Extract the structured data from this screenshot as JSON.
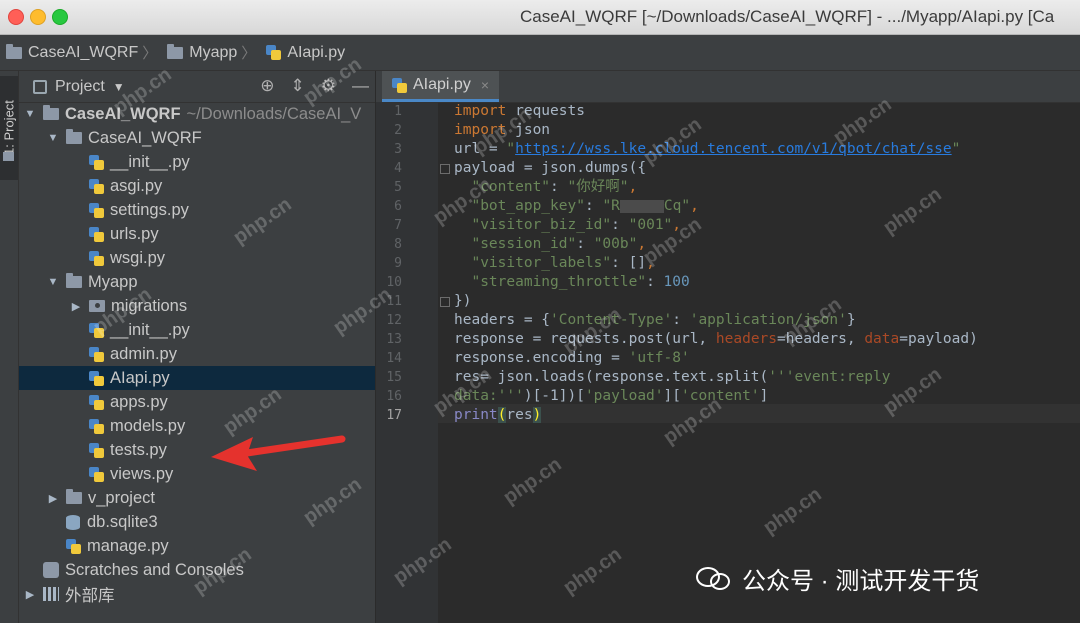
{
  "window": {
    "title": "CaseAI_WQRF [~/Downloads/CaseAI_WQRF] - .../Myapp/AIapi.py [Ca"
  },
  "breadcrumb": [
    "CaseAI_WQRF",
    "Myapp",
    "AIapi.py"
  ],
  "side_strip": {
    "tab_label": "1: Project"
  },
  "project_panel": {
    "title": "Project",
    "tools": [
      "⊕",
      "⇕",
      "⚙",
      "—"
    ],
    "tree": [
      {
        "label": "CaseAI_WQRF",
        "extra": "~/Downloads/CaseAI_V",
        "kind": "root",
        "arrow": "▼"
      },
      {
        "label": "CaseAI_WQRF",
        "kind": "folder",
        "arrow": "▼"
      },
      {
        "label": "__init__.py",
        "kind": "py"
      },
      {
        "label": "asgi.py",
        "kind": "py"
      },
      {
        "label": "settings.py",
        "kind": "py"
      },
      {
        "label": "urls.py",
        "kind": "py"
      },
      {
        "label": "wsgi.py",
        "kind": "py"
      },
      {
        "label": "Myapp",
        "kind": "folder",
        "arrow": "▼"
      },
      {
        "label": "migrations",
        "kind": "pkg",
        "arrow": "▶"
      },
      {
        "label": "__init__.py",
        "kind": "py"
      },
      {
        "label": "admin.py",
        "kind": "py"
      },
      {
        "label": "AIapi.py",
        "kind": "py",
        "selected": true
      },
      {
        "label": "apps.py",
        "kind": "py"
      },
      {
        "label": "models.py",
        "kind": "py"
      },
      {
        "label": "tests.py",
        "kind": "py"
      },
      {
        "label": "views.py",
        "kind": "py"
      },
      {
        "label": "v_project",
        "kind": "folder",
        "arrow": "▶"
      },
      {
        "label": "db.sqlite3",
        "kind": "db"
      },
      {
        "label": "manage.py",
        "kind": "py"
      },
      {
        "label": "Scratches and Consoles",
        "kind": "scratch"
      },
      {
        "label": "外部库",
        "kind": "lib",
        "arrow": "▶"
      }
    ]
  },
  "editor": {
    "tab_label": "AIapi.py",
    "tab_close": "×",
    "current_line": "17",
    "line_numbers": [
      "1",
      "2",
      "3",
      "4",
      "5",
      "6",
      "7",
      "8",
      "9",
      "10",
      "11",
      "12",
      "13",
      "14",
      "15",
      "16",
      "17"
    ]
  },
  "code": {
    "l1": {
      "kw": "import",
      "rest": " requests"
    },
    "l2": {
      "kw": "import",
      "rest": " json"
    },
    "l3": {
      "pre": "url = ",
      "q1": "\"",
      "url": "https://wss.lke.cloud.tencent.com/v1/qbot/chat/sse",
      "q2": "\""
    },
    "l4": "payload = json.dumps({",
    "l5": {
      "key": "\"content\"",
      "sep": ": ",
      "val": "\"你好啊\"",
      "end": ","
    },
    "l6": {
      "key": "\"bot_app_key\"",
      "sep": ": ",
      "val_a": "\"R",
      "val_b": "Cq\"",
      "end": ","
    },
    "l7": {
      "key": "\"visitor_biz_id\"",
      "sep": ": ",
      "val": "\"001\"",
      "end": ","
    },
    "l8": {
      "key": "\"session_id\"",
      "sep": ": ",
      "val": "\"00b\"",
      "end": ","
    },
    "l9": {
      "key": "\"visitor_labels\"",
      "sep": ": ",
      "val": "[]",
      "end": ","
    },
    "l10": {
      "key": "\"streaming_throttle\"",
      "sep": ": ",
      "val": "100"
    },
    "l11": "})",
    "l12": {
      "pre": "headers = {",
      "k": "'Content-Type'",
      "sep": ": ",
      "v": "'application/json'",
      "end": "}"
    },
    "l13": {
      "pre": "response = requests.post(url, ",
      "p1": "headers",
      "m1": "=headers, ",
      "p2": "data",
      "m2": "=payload)"
    },
    "l14": {
      "pre": "response.encoding = ",
      "v": "'utf-8'"
    },
    "l15": {
      "pre": "res= json.loads(response.text.split(",
      "v": "'''event:reply"
    },
    "l16": {
      "v": "data:'''",
      "m": ")[-1])[",
      "k1": "'payload'",
      "m2": "][",
      "k2": "'content'",
      "end": "]"
    },
    "l17": {
      "fn": "print",
      "open": "(",
      "arg": "res",
      "close": ")"
    }
  },
  "watermark": {
    "text": "php.cn",
    "badge": "公众号 · 测试开发干货"
  },
  "colors": {
    "selection": "#0d293e",
    "arrow": "#e5322d",
    "keyword": "#cc7832",
    "string": "#6a8759"
  }
}
